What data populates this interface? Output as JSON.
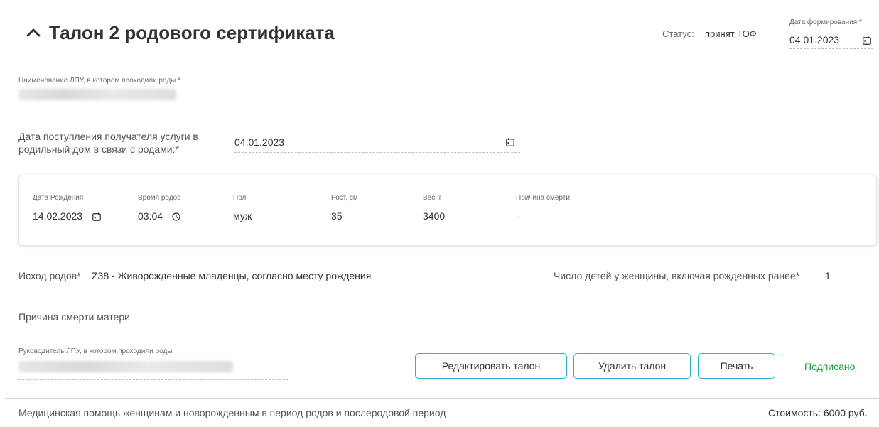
{
  "header": {
    "title": "Талон 2 родового сертификата",
    "status_label": "Статус:",
    "status_value": "принят ТОФ",
    "formation_date_label": "Дата формирования *",
    "formation_date_value": "04.01.2023"
  },
  "lpu": {
    "label": "Наименование ЛПУ, в котором проходили роды *"
  },
  "admission": {
    "label_line1": "Дата поступления получателя услуги в",
    "label_line2": "родильный дом в связи с родами:*",
    "value": "04.01.2023"
  },
  "child": {
    "birth_date_label": "Дата Рождения",
    "birth_date_value": "14.02.2023",
    "birth_time_label": "Время родов",
    "birth_time_value": "03:04",
    "sex_label": "Пол",
    "sex_value": "муж",
    "height_label": "Рост, см",
    "height_value": "35",
    "weight_label": "Вес, г",
    "weight_value": "3400",
    "death_cause_label": "Причина смерти",
    "death_cause_value": "-"
  },
  "outcome": {
    "label": "Исход родов*",
    "value": "Z38 - Живорожденные младенцы, согласно месту рождения",
    "children_count_label": "Число детей у женщины, включая рожденных ранее*",
    "children_count_value": "1"
  },
  "mother_death": {
    "label": "Причина смерти матери"
  },
  "head": {
    "label": "Руководитель ЛПУ, в котором проходили роды"
  },
  "actions": {
    "edit_label": "Редактировать талон",
    "delete_label": "Удалить талон",
    "print_label": "Печать",
    "signed_label": "Подписано"
  },
  "footer": {
    "description": "Медицинская помощь женщинам и новорожденным в период родов и послеродовой период",
    "cost": "Стоимость: 6000 руб."
  },
  "icons": {
    "collapse": "chevron-up-icon",
    "calendar": "calendar-icon",
    "clock": "clock-icon"
  },
  "colors": {
    "accent": "#2bb3c6",
    "signed": "#1f9a3a"
  }
}
